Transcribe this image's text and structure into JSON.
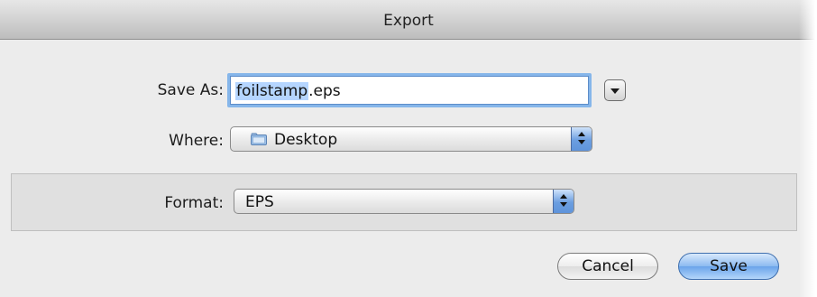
{
  "window": {
    "title": "Export"
  },
  "save_as": {
    "label": "Save As:",
    "value_selected": "foilstamp",
    "value_rest": ".eps"
  },
  "where": {
    "label": "Where:",
    "value": "Desktop",
    "icon": "folder-icon"
  },
  "format": {
    "label": "Format:",
    "value": "EPS"
  },
  "buttons": {
    "cancel": "Cancel",
    "save": "Save"
  },
  "colors": {
    "default_button": "#6aa4ea",
    "focus_ring": "#86b6ea",
    "text_selection": "#b5d5ff"
  }
}
